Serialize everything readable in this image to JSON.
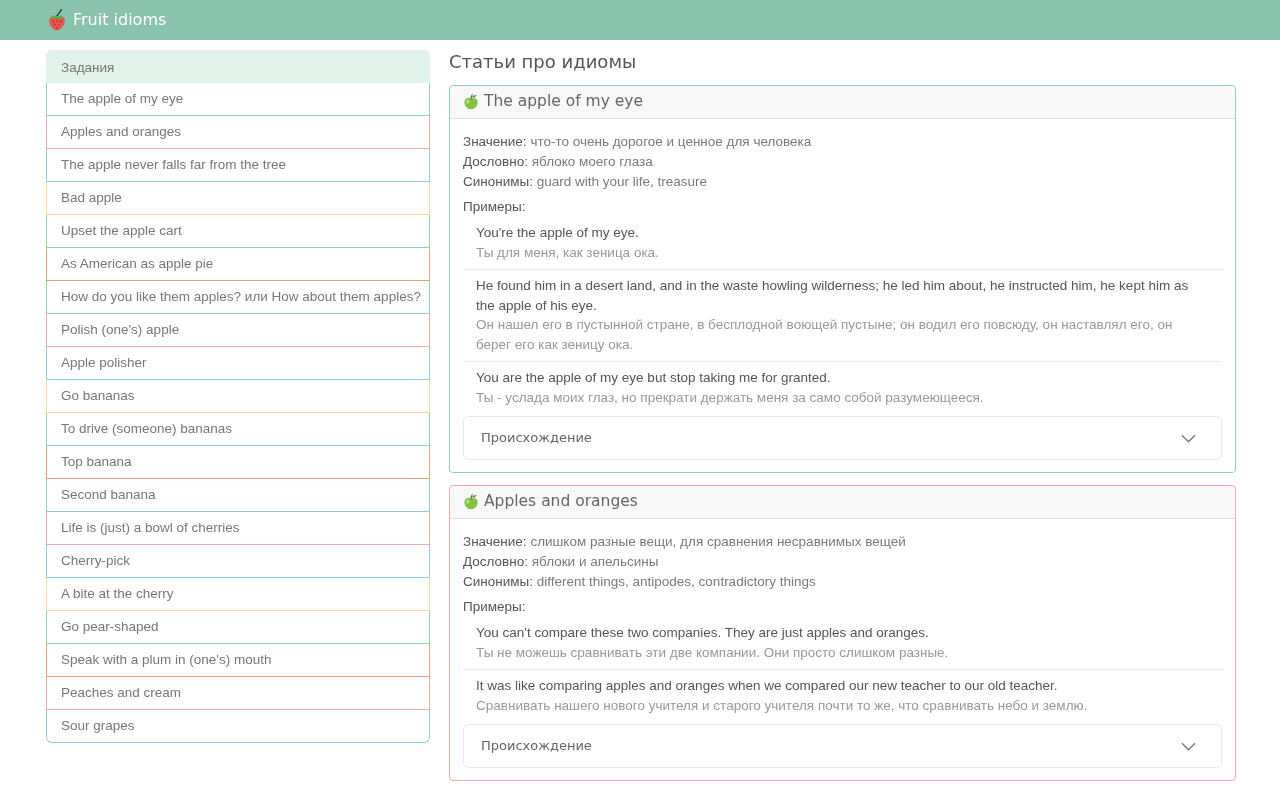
{
  "navbar": {
    "title": "Fruit idioms"
  },
  "sidebar": {
    "header": "Задания",
    "items": [
      {
        "label": "The apple of my eye",
        "color": "#8fd3b4"
      },
      {
        "label": "Apples and oranges",
        "color": "#f2aaaa"
      },
      {
        "label": "The apple never falls far from the tree",
        "color": "#92cfe0"
      },
      {
        "label": "Bad apple",
        "color": "#f8dc92"
      },
      {
        "label": "Upset the apple cart",
        "color": "#8fd3b4"
      },
      {
        "label": "As American as apple pie",
        "color": "#f29a7b"
      },
      {
        "label": "How do you like them apples? или How about them apples?",
        "color": "#8fd3b4"
      },
      {
        "label": "Polish (one's) apple",
        "color": "#f2aaaa"
      },
      {
        "label": "Apple polisher",
        "color": "#92cfe0"
      },
      {
        "label": "Go bananas",
        "color": "#f8dc92"
      },
      {
        "label": "To drive (someone) bananas",
        "color": "#8fd3b4"
      },
      {
        "label": "Top banana",
        "color": "#f29a7b"
      },
      {
        "label": "Second banana",
        "color": "#8fd3b4"
      },
      {
        "label": "Life is (just) a bowl of cherries",
        "color": "#f2aaaa"
      },
      {
        "label": "Cherry-pick",
        "color": "#92cfe0"
      },
      {
        "label": "A bite at the cherry",
        "color": "#f8dc92"
      },
      {
        "label": "Go pear-shaped",
        "color": "#8fd3b4"
      },
      {
        "label": "Speak with a plum in (one's) mouth",
        "color": "#f29a7b"
      },
      {
        "label": "Peaches and cream",
        "color": "#f2aaaa"
      },
      {
        "label": "Sour grapes",
        "color": "#92cfe0"
      }
    ]
  },
  "main": {
    "heading": "Статьи про идиомы",
    "articles": [
      {
        "title": "The apple of my eye",
        "color": "#8fd3b4",
        "fields": [
          {
            "label": "Значение:",
            "value": "что-то очень дорогое и ценное для человека"
          },
          {
            "label": "Дословно:",
            "value": "яблоко моего глаза"
          },
          {
            "label": "Синонимы:",
            "value": "guard with your life, treasure"
          }
        ],
        "examples_label": "Примеры:",
        "examples": [
          {
            "text": "You're the apple of my eye.",
            "translation": "Ты для меня, как зеница ока."
          },
          {
            "text": "He found him in a desert land, and in the waste howling wilderness; he led him about, he instructed him, he kept him as the apple of his eye.",
            "translation": "Он нашел его в пустынной стране, в бесплодной воющей пустыне; он водил его повсюду, он наставлял его, он берег его как зеницу ока."
          },
          {
            "text": "You are the apple of my eye but stop taking me for granted.",
            "translation": "Ты - услада моих глаз, но прекрати держать меня за само собой разумеющееся."
          }
        ],
        "origin": {
          "label": "Происхождение",
          "expanded": false
        }
      },
      {
        "title": "Apples and oranges",
        "color": "#f2aaaa",
        "fields": [
          {
            "label": "Значение:",
            "value": "слишком разные вещи, для сравнения несравнимых вещей"
          },
          {
            "label": "Дословно:",
            "value": "яблоки и апельсины"
          },
          {
            "label": "Синонимы:",
            "value": "different things, antipodes, contradictory things"
          }
        ],
        "examples_label": "Примеры:",
        "examples": [
          {
            "text": "You can't compare these two companies. They are just apples and oranges.",
            "translation": "Ты не можешь сравнивать эти две компании. Они просто слишком разные."
          },
          {
            "text": "It was like comparing apples and oranges when we compared our new teacher to our old teacher.",
            "translation": "Сравнивать нашего нового учителя и старого учителя почти то же, что сравнивать небо и землю."
          }
        ],
        "origin": {
          "label": "Происхождение",
          "expanded": false
        }
      }
    ]
  }
}
